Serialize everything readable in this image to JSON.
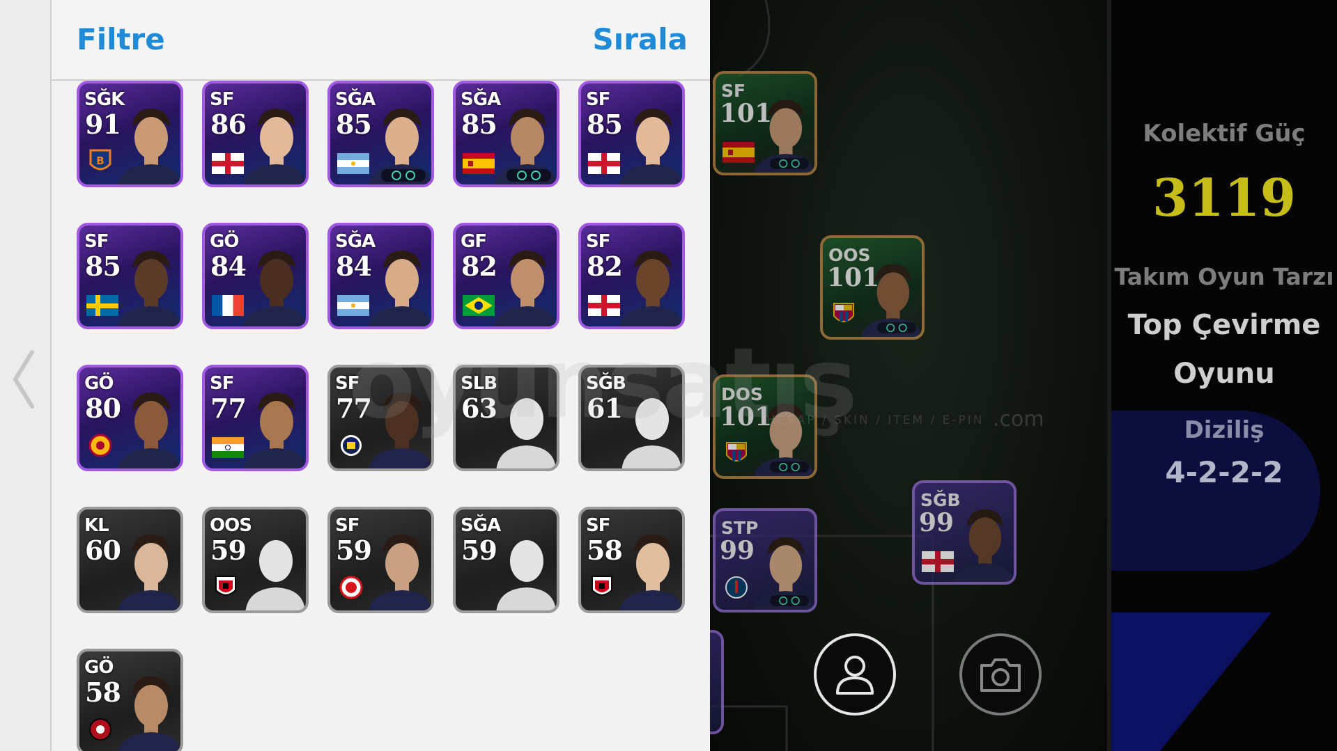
{
  "panel": {
    "filter_label": "Filtre",
    "sort_label": "Sırala"
  },
  "cards": [
    {
      "pos": "SĞK",
      "ovr": "91",
      "tier": "epic",
      "emblem": "basaksehir-badge",
      "skin": "#c99a74"
    },
    {
      "pos": "SF",
      "ovr": "86",
      "tier": "epic",
      "emblem": "england-flag",
      "skin": "#e2b999"
    },
    {
      "pos": "SĞA",
      "ovr": "85",
      "tier": "epic",
      "emblem": "argentina-flag",
      "skin": "#dcb08c"
    },
    {
      "pos": "SĞA",
      "ovr": "85",
      "tier": "epic",
      "emblem": "spain-flag",
      "skin": "#b58863"
    },
    {
      "pos": "SF",
      "ovr": "85",
      "tier": "epic",
      "emblem": "england-flag",
      "skin": "#e2b999"
    },
    {
      "pos": "SF",
      "ovr": "85",
      "tier": "epic",
      "emblem": "sweden-flag",
      "skin": "#5c3b28"
    },
    {
      "pos": "GÖ",
      "ovr": "84",
      "tier": "epic",
      "emblem": "france-flag",
      "skin": "#4a2e1f"
    },
    {
      "pos": "SĞA",
      "ovr": "84",
      "tier": "epic",
      "emblem": "argentina-flag",
      "skin": "#d9ac88"
    },
    {
      "pos": "GF",
      "ovr": "82",
      "tier": "epic",
      "emblem": "brazil-flag",
      "skin": "#c0906c"
    },
    {
      "pos": "SF",
      "ovr": "82",
      "tier": "epic",
      "emblem": "england-flag",
      "skin": "#6b442c"
    },
    {
      "pos": "GÖ",
      "ovr": "80",
      "tier": "epic",
      "emblem": "galatasaray-badge",
      "skin": "#8a5a3b"
    },
    {
      "pos": "SF",
      "ovr": "77",
      "tier": "epic",
      "emblem": "india-flag",
      "skin": "#a8764f"
    },
    {
      "pos": "SF",
      "ovr": "77",
      "tier": "silver",
      "emblem": "fenerbahce-badge",
      "skin": "#4b2f20"
    },
    {
      "pos": "SLB",
      "ovr": "63",
      "tier": "silver",
      "emblem": "none",
      "skin": "#dcdcdc"
    },
    {
      "pos": "SĞB",
      "ovr": "61",
      "tier": "silver",
      "emblem": "none",
      "skin": "#dcdcdc"
    },
    {
      "pos": "KL",
      "ovr": "60",
      "tier": "silver",
      "emblem": "none",
      "skin": "#d9b59a"
    },
    {
      "pos": "OOS",
      "ovr": "59",
      "tier": "silver",
      "emblem": "gaziantep-badge",
      "skin": "#dcdcdc"
    },
    {
      "pos": "SF",
      "ovr": "59",
      "tier": "silver",
      "emblem": "antalyaspor-badge",
      "skin": "#c9a081"
    },
    {
      "pos": "SĞA",
      "ovr": "59",
      "tier": "silver",
      "emblem": "none",
      "skin": "#dcdcdc"
    },
    {
      "pos": "SF",
      "ovr": "58",
      "tier": "silver",
      "emblem": "gaziantep-badge",
      "skin": "#e1bf9e"
    },
    {
      "pos": "GÖ",
      "ovr": "58",
      "tier": "silver",
      "emblem": "karagumruk-badge",
      "skin": "#b98a66"
    }
  ],
  "pitch_slots": [
    {
      "pos": "SF",
      "ovr": "101",
      "tier": "gold",
      "emblem": "spain-flag",
      "skin": "#c49573"
    },
    {
      "pos": "OOS",
      "ovr": "101",
      "tier": "gold",
      "emblem": "barcelona-badge",
      "skin": "#8a5a3b"
    },
    {
      "pos": "DOS",
      "ovr": "101",
      "tier": "gold",
      "emblem": "barcelona-badge",
      "skin": "#c9a081"
    },
    {
      "pos": "STP",
      "ovr": "99",
      "tier": "purple",
      "emblem": "psg-badge",
      "skin": "#d4a985"
    },
    {
      "pos": "SĞB",
      "ovr": "99",
      "tier": "purple",
      "emblem": "england-flag",
      "skin": "#6a442c"
    }
  ],
  "info": {
    "collective_power_label": "Kolektif Güç",
    "collective_power_value": "3119",
    "team_style_label": "Takım Oyun Tarzı",
    "team_style_value_line1": "Top Çevirme",
    "team_style_value_line2": "Oyunu",
    "formation_label": "Diziliş",
    "formation_value": "4-2-2-2"
  },
  "watermark": {
    "main": "oyunsatış",
    "sub": "HESAP / SKIN / ITEM / E-PIN",
    "suffix": ".com"
  },
  "icons": {
    "back": "chevron-left-icon",
    "player": "user-icon",
    "camera": "camera-icon"
  },
  "colors": {
    "accent": "#1f8ad8",
    "collective_power": "#c7bd18",
    "epic_border": "#a158e3",
    "silver_border": "#9a9a9a",
    "gold_border": "#b08040"
  }
}
